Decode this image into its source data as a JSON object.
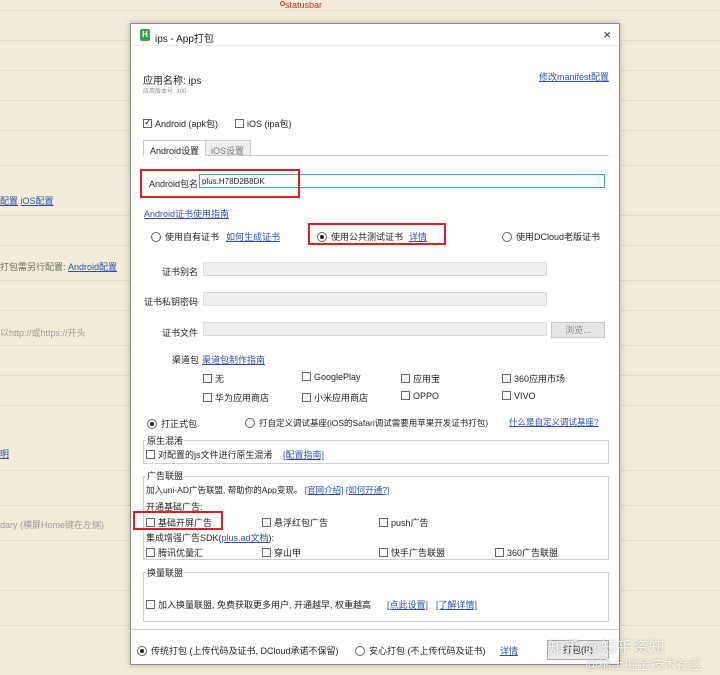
{
  "background": {
    "top_tag": "statusbar",
    "lines": [
      {
        "prefix": "",
        "link1": "配置",
        "sep": "  ",
        "link2": "iOS配置",
        "suffix": ""
      },
      {
        "prefix": "打包需另行配置: ",
        "link1": "Android配置",
        "sep": "",
        "link2": "",
        "suffix": ""
      },
      {
        "prefix": "以http://或https://开头",
        "link1": "",
        "sep": "",
        "link2": "",
        "suffix": ""
      },
      {
        "prefix": "",
        "link1": "明",
        "sep": "",
        "link2": "",
        "suffix": ""
      },
      {
        "prefix": "dary (横屏Home键在左侧)",
        "link1": "",
        "sep": "",
        "link2": "",
        "suffix": ""
      }
    ]
  },
  "dialog": {
    "title": "ips - App打包",
    "close": "×",
    "app_name_label": "应用名称: ips",
    "app_version_label": "应用版本号: 100",
    "manifest_link": "修改manifest配置",
    "platforms": {
      "android": "Android (apk包)",
      "ios": "iOS (ipa包)"
    },
    "tabs": [
      "Android设置",
      "iOS设置"
    ],
    "android": {
      "package_label": "Android包名",
      "package_value": "plus.H78D2B8DK",
      "cert_guide_link": "Android证书使用指南",
      "cert_options": {
        "own": "使用自有证书",
        "own_link": "如何生成证书",
        "public": "使用公共测试证书",
        "public_link": "详情",
        "dcloud": "使用DCloud老版证书"
      },
      "cert_alias_label": "证书别名",
      "cert_password_label": "证书私钥密码",
      "cert_file_label": "证书文件",
      "browse_button": "浏览...",
      "channel_label": "渠道包",
      "channel_link": "渠道包制作指南",
      "channels": [
        "无",
        "GooglePlay",
        "应用宝",
        "360应用市场",
        "华为应用商店",
        "小米应用商店",
        "OPPO",
        "VIVO"
      ]
    },
    "build_mode": {
      "release": "打正式包",
      "custom": "打自定义调试基座(iOS的Safari调试需要用苹果开发证书打包)",
      "custom_link": "什么是自定义调试基座?"
    },
    "obfuscation": {
      "title": "原生混淆",
      "checkbox": "对配置的js文件进行原生混淆",
      "link": "[配置指南]"
    },
    "ads": {
      "title": "广告联盟",
      "intro": "加入uni-AD广告联盟, 帮助你的App变现。",
      "intro_link1": "[官网介绍]",
      "intro_link2": "[如何开通?]",
      "basic_label": "开通基础广告:",
      "basic": [
        "基础开屏广告",
        "悬浮红包广告",
        "push广告"
      ],
      "sdk_label_prefix": "集成增强广告SDK(",
      "sdk_link": "plus.ad文档",
      "sdk_label_suffix": "):",
      "sdk": [
        "腾讯优量汇",
        "穿山甲",
        "快手广告联盟",
        "360广告联盟"
      ]
    },
    "exchange": {
      "title": "换量联盟",
      "checkbox": "加入换量联盟, 免费获取更多用户, 开通越早, 权重越高",
      "link1": "[点此设置]",
      "link2": "[了解详情]"
    },
    "footer": {
      "traditional": "传统打包 (上传代码及证书, DCloud承诺不保留)",
      "safe": "安心打包 (不上传代码及证书)",
      "detail_link": "详情",
      "build_button": "打包(P)"
    }
  },
  "watermarks": {
    "line1": "知乎 @知乎资知",
    "line2": "@稀土掘金技术社区"
  },
  "colors": {
    "highlight_red": "#e02020",
    "link_blue": "#2a4fb0",
    "background_beige": "#f3ecd8"
  }
}
